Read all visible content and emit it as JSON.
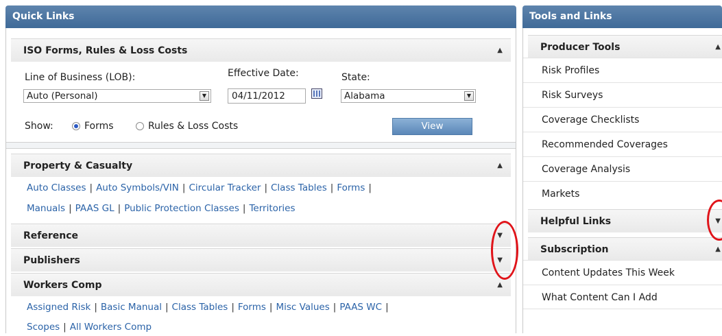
{
  "quick_links": {
    "title": "Quick Links",
    "iso": {
      "title": "ISO Forms, Rules & Loss Costs",
      "lob_label": "Line of Business (LOB):",
      "lob_value": "Auto (Personal)",
      "date_label": "Effective Date:",
      "date_value": "04/11/2012",
      "state_label": "State:",
      "state_value": "Alabama",
      "show_label": "Show:",
      "opt_forms": "Forms",
      "opt_rules": "Rules & Loss Costs",
      "selected": "Forms",
      "view_button": "View"
    },
    "property": {
      "title": "Property & Casualty",
      "row1": [
        "Auto Classes",
        "Auto Symbols/VIN",
        "Circular Tracker",
        "Class Tables",
        "Forms"
      ],
      "row2": [
        "Manuals",
        "PAAS GL",
        "Public Protection Classes",
        "Territories"
      ]
    },
    "reference": {
      "title": "Reference"
    },
    "publishers": {
      "title": "Publishers"
    },
    "workers": {
      "title": "Workers Comp",
      "row1": [
        "Assigned Risk",
        "Basic Manual",
        "Class Tables",
        "Forms",
        "Misc Values",
        "PAAS WC"
      ],
      "row2": [
        "Scopes",
        "All Workers Comp"
      ]
    }
  },
  "tools_links": {
    "title": "Tools and Links",
    "producer": {
      "title": "Producer Tools",
      "items": [
        "Risk Profiles",
        "Risk Surveys",
        "Coverage Checklists",
        "Recommended Coverages",
        "Coverage Analysis",
        "Markets"
      ]
    },
    "helpful": {
      "title": "Helpful Links"
    },
    "subscription": {
      "title": "Subscription",
      "items": [
        "Content Updates This Week",
        "What Content Can I Add"
      ]
    }
  },
  "colors": {
    "header_blue": "#4a74a2",
    "link_blue": "#2b63a8",
    "annotation_red": "#e0141a"
  },
  "icons": {
    "expanded": "triangle-up",
    "collapsed": "triangle-down",
    "calendar": "calendar-icon"
  }
}
